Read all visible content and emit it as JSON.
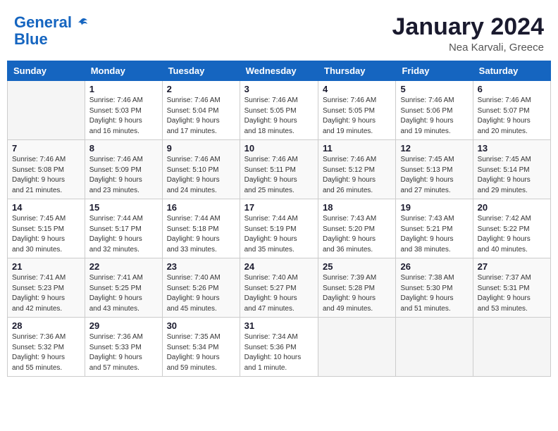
{
  "logo": {
    "line1": "General",
    "line2": "Blue"
  },
  "title": "January 2024",
  "location": "Nea Karvali, Greece",
  "days_header": [
    "Sunday",
    "Monday",
    "Tuesday",
    "Wednesday",
    "Thursday",
    "Friday",
    "Saturday"
  ],
  "weeks": [
    [
      {
        "num": "",
        "info": ""
      },
      {
        "num": "1",
        "info": "Sunrise: 7:46 AM\nSunset: 5:03 PM\nDaylight: 9 hours\nand 16 minutes."
      },
      {
        "num": "2",
        "info": "Sunrise: 7:46 AM\nSunset: 5:04 PM\nDaylight: 9 hours\nand 17 minutes."
      },
      {
        "num": "3",
        "info": "Sunrise: 7:46 AM\nSunset: 5:05 PM\nDaylight: 9 hours\nand 18 minutes."
      },
      {
        "num": "4",
        "info": "Sunrise: 7:46 AM\nSunset: 5:05 PM\nDaylight: 9 hours\nand 19 minutes."
      },
      {
        "num": "5",
        "info": "Sunrise: 7:46 AM\nSunset: 5:06 PM\nDaylight: 9 hours\nand 19 minutes."
      },
      {
        "num": "6",
        "info": "Sunrise: 7:46 AM\nSunset: 5:07 PM\nDaylight: 9 hours\nand 20 minutes."
      }
    ],
    [
      {
        "num": "7",
        "info": "Sunrise: 7:46 AM\nSunset: 5:08 PM\nDaylight: 9 hours\nand 21 minutes."
      },
      {
        "num": "8",
        "info": "Sunrise: 7:46 AM\nSunset: 5:09 PM\nDaylight: 9 hours\nand 23 minutes."
      },
      {
        "num": "9",
        "info": "Sunrise: 7:46 AM\nSunset: 5:10 PM\nDaylight: 9 hours\nand 24 minutes."
      },
      {
        "num": "10",
        "info": "Sunrise: 7:46 AM\nSunset: 5:11 PM\nDaylight: 9 hours\nand 25 minutes."
      },
      {
        "num": "11",
        "info": "Sunrise: 7:46 AM\nSunset: 5:12 PM\nDaylight: 9 hours\nand 26 minutes."
      },
      {
        "num": "12",
        "info": "Sunrise: 7:45 AM\nSunset: 5:13 PM\nDaylight: 9 hours\nand 27 minutes."
      },
      {
        "num": "13",
        "info": "Sunrise: 7:45 AM\nSunset: 5:14 PM\nDaylight: 9 hours\nand 29 minutes."
      }
    ],
    [
      {
        "num": "14",
        "info": "Sunrise: 7:45 AM\nSunset: 5:15 PM\nDaylight: 9 hours\nand 30 minutes."
      },
      {
        "num": "15",
        "info": "Sunrise: 7:44 AM\nSunset: 5:17 PM\nDaylight: 9 hours\nand 32 minutes."
      },
      {
        "num": "16",
        "info": "Sunrise: 7:44 AM\nSunset: 5:18 PM\nDaylight: 9 hours\nand 33 minutes."
      },
      {
        "num": "17",
        "info": "Sunrise: 7:44 AM\nSunset: 5:19 PM\nDaylight: 9 hours\nand 35 minutes."
      },
      {
        "num": "18",
        "info": "Sunrise: 7:43 AM\nSunset: 5:20 PM\nDaylight: 9 hours\nand 36 minutes."
      },
      {
        "num": "19",
        "info": "Sunrise: 7:43 AM\nSunset: 5:21 PM\nDaylight: 9 hours\nand 38 minutes."
      },
      {
        "num": "20",
        "info": "Sunrise: 7:42 AM\nSunset: 5:22 PM\nDaylight: 9 hours\nand 40 minutes."
      }
    ],
    [
      {
        "num": "21",
        "info": "Sunrise: 7:41 AM\nSunset: 5:23 PM\nDaylight: 9 hours\nand 42 minutes."
      },
      {
        "num": "22",
        "info": "Sunrise: 7:41 AM\nSunset: 5:25 PM\nDaylight: 9 hours\nand 43 minutes."
      },
      {
        "num": "23",
        "info": "Sunrise: 7:40 AM\nSunset: 5:26 PM\nDaylight: 9 hours\nand 45 minutes."
      },
      {
        "num": "24",
        "info": "Sunrise: 7:40 AM\nSunset: 5:27 PM\nDaylight: 9 hours\nand 47 minutes."
      },
      {
        "num": "25",
        "info": "Sunrise: 7:39 AM\nSunset: 5:28 PM\nDaylight: 9 hours\nand 49 minutes."
      },
      {
        "num": "26",
        "info": "Sunrise: 7:38 AM\nSunset: 5:30 PM\nDaylight: 9 hours\nand 51 minutes."
      },
      {
        "num": "27",
        "info": "Sunrise: 7:37 AM\nSunset: 5:31 PM\nDaylight: 9 hours\nand 53 minutes."
      }
    ],
    [
      {
        "num": "28",
        "info": "Sunrise: 7:36 AM\nSunset: 5:32 PM\nDaylight: 9 hours\nand 55 minutes."
      },
      {
        "num": "29",
        "info": "Sunrise: 7:36 AM\nSunset: 5:33 PM\nDaylight: 9 hours\nand 57 minutes."
      },
      {
        "num": "30",
        "info": "Sunrise: 7:35 AM\nSunset: 5:34 PM\nDaylight: 9 hours\nand 59 minutes."
      },
      {
        "num": "31",
        "info": "Sunrise: 7:34 AM\nSunset: 5:36 PM\nDaylight: 10 hours\nand 1 minute."
      },
      {
        "num": "",
        "info": ""
      },
      {
        "num": "",
        "info": ""
      },
      {
        "num": "",
        "info": ""
      }
    ]
  ]
}
